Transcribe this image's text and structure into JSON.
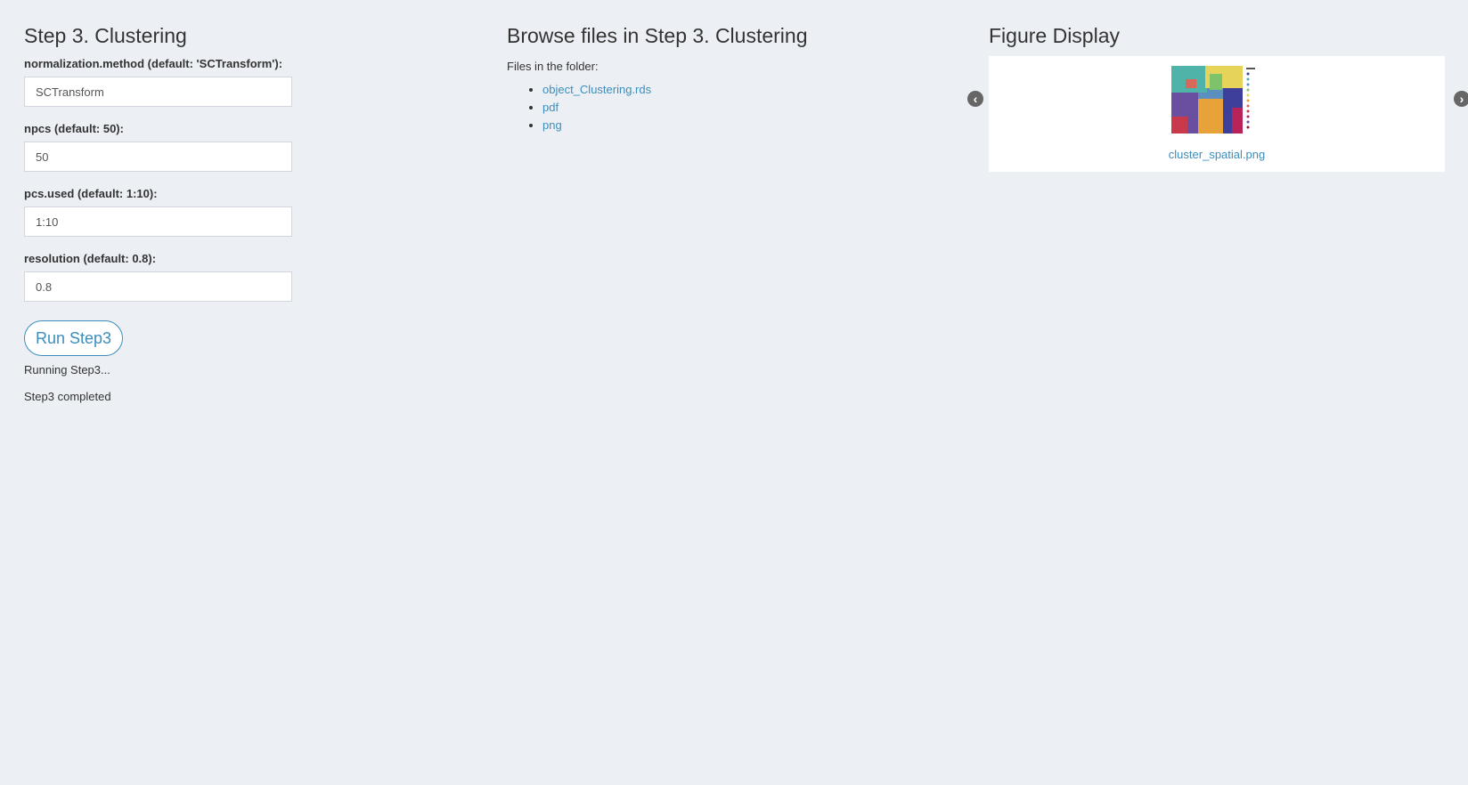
{
  "left": {
    "title": "Step 3. Clustering",
    "fields": [
      {
        "label": "normalization.method (default: 'SCTransform'):",
        "value": "SCTransform"
      },
      {
        "label": "npcs (default: 50):",
        "value": "50"
      },
      {
        "label": "pcs.used (default: 1:10):",
        "value": "1:10"
      },
      {
        "label": "resolution (default: 0.8):",
        "value": "0.8"
      }
    ],
    "run_button": "Run Step3",
    "status_running": "Running Step3...",
    "status_done": "Step3 completed"
  },
  "middle": {
    "title": "Browse files in Step 3. Clustering",
    "caption": "Files in the folder:",
    "files": [
      "object_Clustering.rds",
      "pdf",
      "png"
    ]
  },
  "right": {
    "title": "Figure Display",
    "figure_name": "cluster_spatial.png",
    "prev_icon": "chevron-left-circle-icon",
    "next_icon": "chevron-right-circle-icon"
  },
  "colors": {
    "background": "#ecf0f5",
    "accent": "#3c8dbc"
  }
}
